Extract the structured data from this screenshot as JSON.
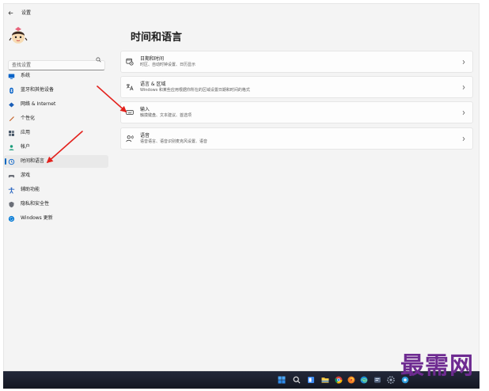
{
  "window": {
    "title": "设置",
    "back_icon": "back-arrow-icon"
  },
  "avatar": {
    "icon": "cartoon-character-avatar"
  },
  "search": {
    "placeholder": "查找设置",
    "icon": "search-icon"
  },
  "sidebar": {
    "items": [
      {
        "label": "系统",
        "icon": "monitor-icon",
        "icon_color": "#0a64c8",
        "selected": false
      },
      {
        "label": "蓝牙和其他设备",
        "icon": "bluetooth-icon",
        "icon_color": "#0a64c8",
        "selected": false
      },
      {
        "label": "网络 & Internet",
        "icon": "network-icon",
        "icon_color": "#1b5fb8",
        "selected": false
      },
      {
        "label": "个性化",
        "icon": "brush-icon",
        "icon_color": "#c2591b",
        "selected": false
      },
      {
        "label": "应用",
        "icon": "apps-icon",
        "icon_color": "#3b4b5e",
        "selected": false
      },
      {
        "label": "帐户",
        "icon": "account-icon",
        "icon_color": "#1a9c7a",
        "selected": false
      },
      {
        "label": "时间和语言",
        "icon": "globe-clock-icon",
        "icon_color": "#0a64c8",
        "selected": true
      },
      {
        "label": "游戏",
        "icon": "gamepad-icon",
        "icon_color": "#6b6f78",
        "selected": false
      },
      {
        "label": "辅助功能",
        "icon": "accessibility-icon",
        "icon_color": "#1f5fbf",
        "selected": false
      },
      {
        "label": "隐私和安全性",
        "icon": "shield-icon",
        "icon_color": "#6b6f78",
        "selected": false
      },
      {
        "label": "Windows 更新",
        "icon": "windows-update-icon",
        "icon_color": "#0078d4",
        "selected": false
      }
    ]
  },
  "main": {
    "title": "时间和语言",
    "cards": [
      {
        "title": "日期和时间",
        "subtitle": "时区、自动时钟设置、日历显示",
        "icon": "calendar-clock-icon"
      },
      {
        "title": "语言 & 区域",
        "subtitle": "Windows 和某些应用根据你所在的区域设置日期和时间的格式",
        "icon": "language-icon"
      },
      {
        "title": "输入",
        "subtitle": "触摸键盘、文本建议、首选项",
        "icon": "keyboard-icon"
      },
      {
        "title": "语音",
        "subtitle": "语音语言、语音识别麦克风设置、语音",
        "icon": "speech-icon"
      }
    ]
  },
  "taskbar": {
    "icons": [
      "windows-start-icon",
      "search-icon",
      "task-view-icon",
      "file-explorer-icon",
      "chrome-icon",
      "browser-icon",
      "edge-icon",
      "app-icon",
      "settings-gear-icon",
      "app-circle-icon"
    ]
  },
  "watermark": {
    "text": "最需网",
    "color": "#6e2b91"
  },
  "colors": {
    "accent": "#0067c0",
    "window_bg": "#f4f4f4",
    "card_bg": "#fdfdfd",
    "taskbar_bg": "#23283a",
    "annotation_arrow": "#e3211c"
  }
}
